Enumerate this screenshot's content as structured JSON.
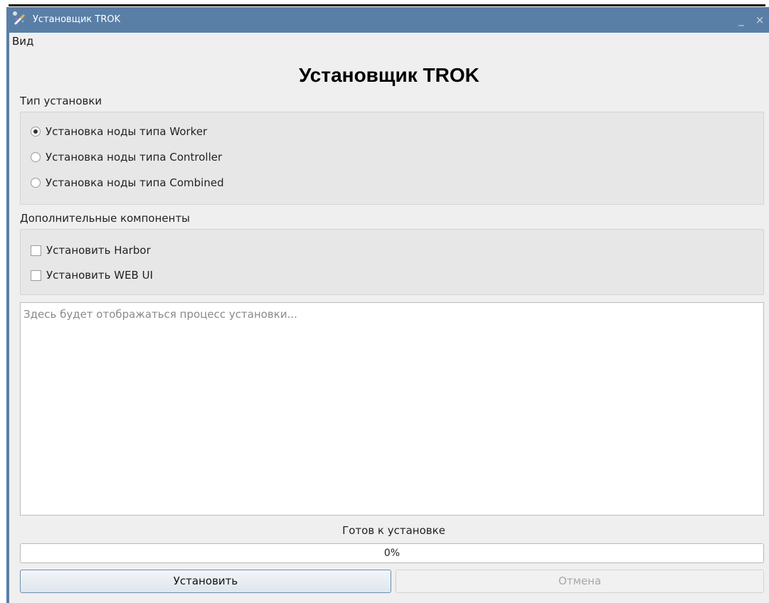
{
  "window": {
    "title": "Установщик TROK",
    "minimize_glyph": "_",
    "close_glyph": "×"
  },
  "menu": {
    "items": [
      {
        "label": "Вид"
      }
    ]
  },
  "main": {
    "title": "Установщик TROK",
    "install_type": {
      "label": "Тип установки",
      "options": [
        {
          "label": "Установка ноды типа Worker",
          "checked": true
        },
        {
          "label": "Установка ноды типа Controller",
          "checked": false
        },
        {
          "label": "Установка ноды типа Combined",
          "checked": false
        }
      ]
    },
    "extra_components": {
      "label": "Дополнительные компоненты",
      "options": [
        {
          "label": "Установить Harbor",
          "checked": false
        },
        {
          "label": "Установить WEB UI",
          "checked": false
        }
      ]
    },
    "log": {
      "placeholder": "Здесь будет отображаться процесс установки..."
    },
    "status": "Готов к установке",
    "progress": {
      "value": 0,
      "text": "0%"
    },
    "buttons": {
      "install": "Установить",
      "cancel": "Отмена"
    }
  },
  "colors": {
    "titlebar": "#5a7fa6",
    "window_bg": "#efefef",
    "groupbox_bg": "#e7e7e7",
    "disabled_text": "#a7a7a7"
  },
  "icons": {
    "app": "installer-wand-icon",
    "minimize": "minimize-icon",
    "close": "close-icon"
  }
}
